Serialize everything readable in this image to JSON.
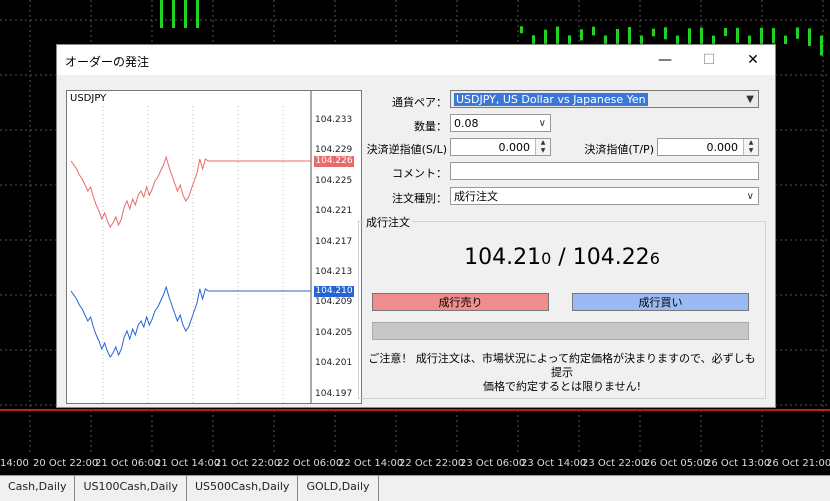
{
  "background": {
    "time_axis": [
      "14:00",
      "20 Oct 22:00",
      "21 Oct 06:00",
      "21 Oct 14:00",
      "21 Oct 22:00",
      "22 Oct 06:00",
      "22 Oct 14:00",
      "22 Oct 22:00",
      "23 Oct 06:00",
      "23 Oct 14:00",
      "23 Oct 22:00",
      "26 Oct 05:00",
      "26 Oct 13:00",
      "26 Oct 21:00"
    ],
    "tabs": [
      "Cash,Daily",
      "US100Cash,Daily",
      "US500Cash,Daily",
      "GOLD,Daily"
    ]
  },
  "dialog": {
    "title": "オーダーの発注",
    "controls": {
      "minimize": "—",
      "maximize": "☐",
      "close": "✕"
    }
  },
  "chart": {
    "symbol": "USDJPY",
    "price_ticks": [
      "104.233",
      "104.229",
      "104.225",
      "104.221",
      "104.217",
      "104.213",
      "104.209",
      "104.205",
      "104.201",
      "104.197"
    ],
    "ask_tag": "104.226",
    "bid_tag": "104.210",
    "colors": {
      "ask": "#e86a6a",
      "bid": "#2464d4"
    }
  },
  "form": {
    "symbol_label": "通貨ペア：",
    "symbol_value": "USDJPY, US Dollar vs Japanese Yen",
    "volume_label": "数量：",
    "volume_value": "0.08",
    "sl_label": "決済逆指値(S/L)",
    "sl_value": "0.000",
    "tp_label": "決済指値(T/P)",
    "tp_value": "0.000",
    "comment_label": "コメント：",
    "comment_value": "",
    "type_label": "注文種別：",
    "type_value": "成行注文"
  },
  "market": {
    "group_title": "成行注文",
    "bid_main": "104.21",
    "bid_small": "0",
    "separator": " / ",
    "ask_main": "104.22",
    "ask_small": "6",
    "sell_label": "成行売り",
    "buy_label": "成行買い",
    "notice_line1": "ご注意！ 成行注文は、市場状況によって約定価格が決まりますので、必ずしも提示",
    "notice_line2": "価格で約定するとは限りません!"
  }
}
